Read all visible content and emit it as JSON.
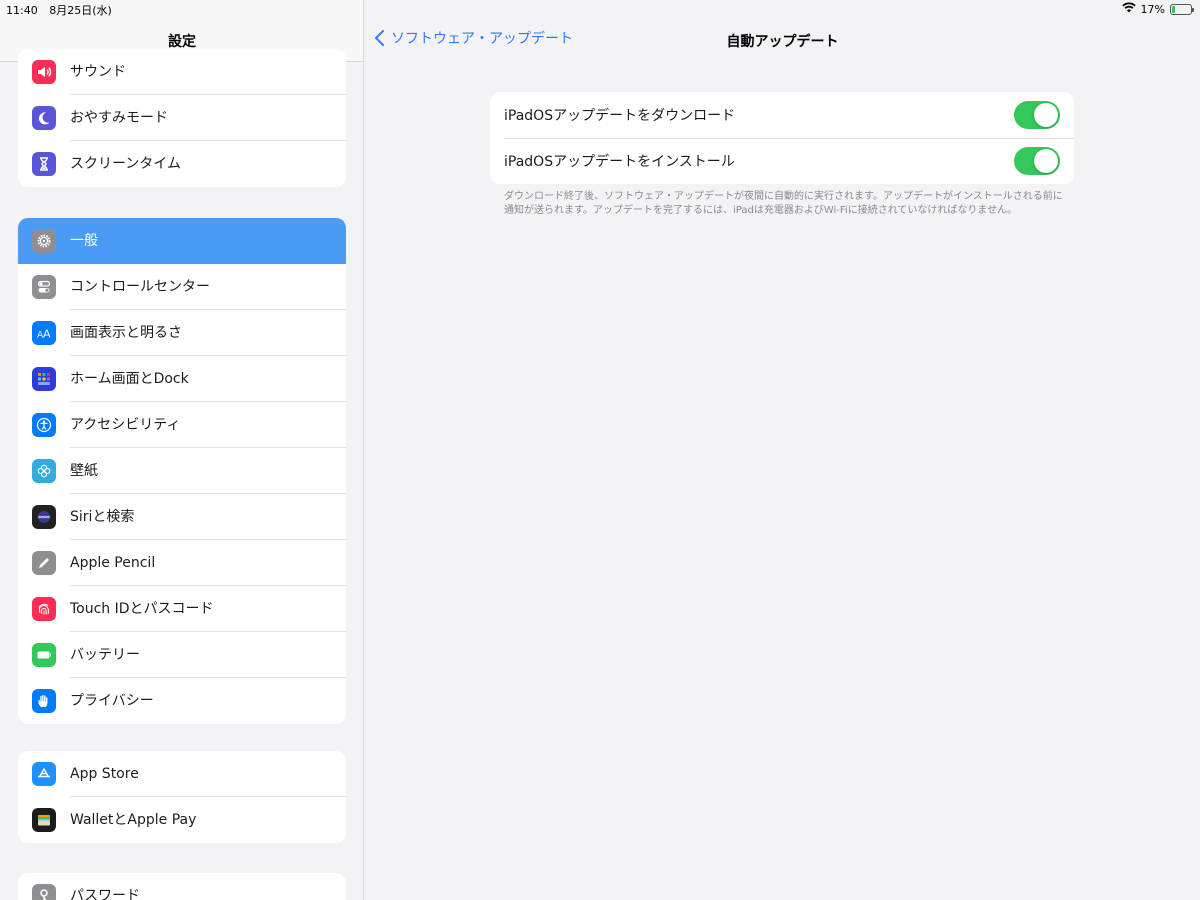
{
  "status": {
    "time": "11:40",
    "date": "8月25日(水)",
    "battery": "17%",
    "battery_level": 0.17,
    "wifi_icon": "wifi-icon"
  },
  "sidebar": {
    "title": "設定",
    "groups": [
      {
        "items": [
          {
            "label": "サウンド",
            "icon": "speaker-icon",
            "color": "#ff2d55"
          },
          {
            "label": "おやすみモード",
            "icon": "moon-icon",
            "color": "#5856d6"
          },
          {
            "label": "スクリーンタイム",
            "icon": "hourglass-icon",
            "color": "#5856d6"
          }
        ]
      },
      {
        "items": [
          {
            "label": "一般",
            "icon": "gear-icon",
            "color": "#8e8e93",
            "selected": true
          },
          {
            "label": "コントロールセンター",
            "icon": "switches-icon",
            "color": "#8e8e93"
          },
          {
            "label": "画面表示と明るさ",
            "icon": "text-size-icon",
            "color": "#007aff"
          },
          {
            "label": "ホーム画面とDock",
            "icon": "grid-icon",
            "color": "#2c3ed6"
          },
          {
            "label": "アクセシビリティ",
            "icon": "accessibility-icon",
            "color": "#007aff"
          },
          {
            "label": "壁紙",
            "icon": "flower-icon",
            "color": "#35aadc"
          },
          {
            "label": "Siriと検索",
            "icon": "siri-icon",
            "color": "#222222"
          },
          {
            "label": "Apple Pencil",
            "icon": "pencil-icon",
            "color": "#8e8e93"
          },
          {
            "label": "Touch IDとパスコード",
            "icon": "fingerprint-icon",
            "color": "#ff2d55"
          },
          {
            "label": "バッテリー",
            "icon": "battery-icon",
            "color": "#34c759"
          },
          {
            "label": "プライバシー",
            "icon": "hand-icon",
            "color": "#007aff"
          }
        ]
      },
      {
        "items": [
          {
            "label": "App Store",
            "icon": "app-store-icon",
            "color": "#1e90ff"
          },
          {
            "label": "WalletとApple Pay",
            "icon": "wallet-icon",
            "color": "#1c1c1e"
          }
        ]
      },
      {
        "items": [
          {
            "label": "パスワード",
            "icon": "key-icon",
            "color": "#8e8e93"
          }
        ]
      }
    ]
  },
  "nav": {
    "back_label": "ソフトウェア・アップデート",
    "title": "自動アップデート"
  },
  "settings": {
    "download_label": "iPadOSアップデートをダウンロード",
    "download_on": true,
    "install_label": "iPadOSアップデートをインストール",
    "install_on": true,
    "footnote": "ダウンロード終了後、ソフトウェア・アップデートが夜間に自動的に実行されます。アップデートがインストールされる前に通知が送られます。アップデートを完了するには、iPadは充電器およびWi-Fiに接続されていなければなりません。"
  },
  "colors": {
    "accent": "#3478f6",
    "selected_row": "#4a9bf6",
    "toggle_on": "#34c759"
  }
}
